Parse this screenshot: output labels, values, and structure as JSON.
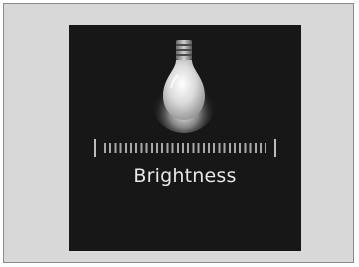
{
  "brightness": {
    "label": "Brightness",
    "icon": "light-bulb-icon"
  }
}
